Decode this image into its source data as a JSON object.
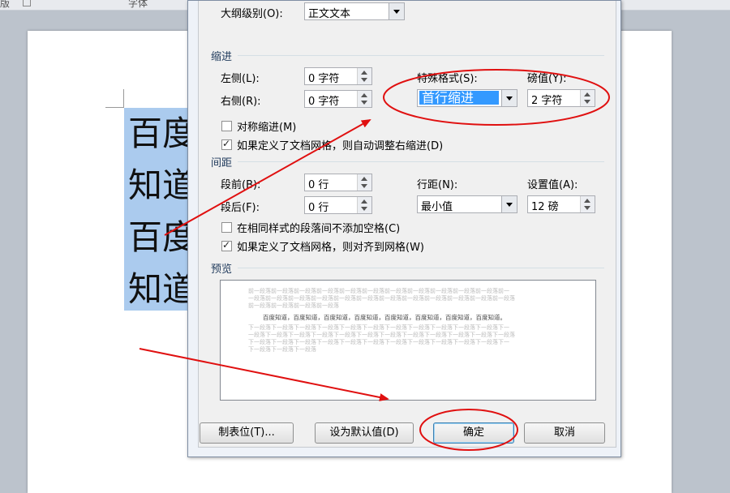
{
  "topbar": {
    "left_text": "版",
    "right_text": "字体"
  },
  "document": {
    "lines": [
      "百度知道",
      "知道百度",
      "百度知道",
      "知道百度"
    ]
  },
  "dialog": {
    "outline_label": "大纲级别(O):",
    "outline_value": "正文文本",
    "indent_section": "缩进",
    "left_label": "左侧(L):",
    "left_value": "0 字符",
    "right_label": "右侧(R):",
    "right_value": "0 字符",
    "special_label": "特殊格式(S):",
    "special_value": "首行缩进",
    "by_label": "磅值(Y):",
    "by_value": "2 字符",
    "mirror_label": "对称缩进(M)",
    "auto_right_label": "如果定义了文档网格，则自动调整右缩进(D)",
    "spacing_section": "间距",
    "before_label": "段前(B):",
    "before_value": "0 行",
    "after_label": "段后(F):",
    "after_value": "0 行",
    "line_spacing_label": "行距(N):",
    "line_spacing_value": "最小值",
    "at_label": "设置值(A):",
    "at_value": "12 磅",
    "no_space_label": "在相同样式的段落间不添加空格(C)",
    "snap_grid_label": "如果定义了文档网格，则对齐到网格(W)",
    "preview_section": "预览",
    "preview_lines": [
      "前一段落前一段落前一段落前一段落前一段落前一段落前一段落前一段落前一段落前一段落前一段落前一",
      "一段落前一段落前一段落前一段落前一段落前一段落前一段落前一段落前一段落前一段落前一段落前一段落",
      "前一段落前一段落前一段落前一段落"
    ],
    "preview_main": "百度知道，百度知道，百度知道，百度知道，百度知道，百度知道，百度知道，百度知道。",
    "preview_after_lines": [
      "下一段落下一段落下一段落下一段落下一段落下一段落下一段落下一段落下一段落下一段落下一段落下一",
      "一段落下一段落下一段落下一段落下一段落下一段落下一段落下一段落下一段落下一段落下一段落下一段落",
      "下一段落下一段落下一段落下一段落下一段落下一段落下一段落下一段落下一段落下一段落下一段落下一",
      "下一段落下一段落下一段落"
    ],
    "tabs_button": "制表位(T)...",
    "default_button": "设为默认值(D)",
    "ok_button": "确定",
    "cancel_button": "取消",
    "mirror_checked": false,
    "auto_right_checked": true,
    "no_space_checked": false,
    "snap_grid_checked": true
  },
  "annotation_color": "#e01010"
}
